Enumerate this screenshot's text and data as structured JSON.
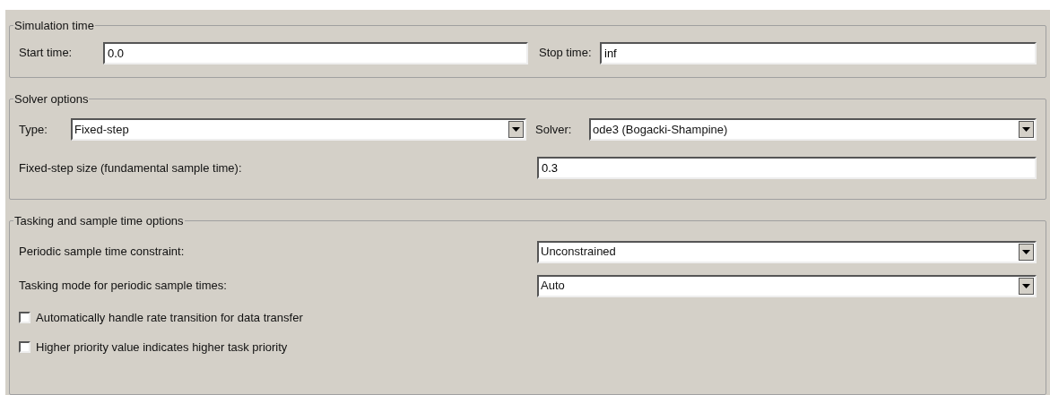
{
  "simulation_time": {
    "title": "Simulation time",
    "start": {
      "label": "Start time:",
      "value": "0.0"
    },
    "stop": {
      "label": "Stop time:",
      "value": "inf"
    }
  },
  "solver_options": {
    "title": "Solver options",
    "type": {
      "label": "Type:",
      "value": "Fixed-step"
    },
    "solver": {
      "label": "Solver:",
      "value": "ode3 (Bogacki-Shampine)"
    },
    "fixed_step_size": {
      "label": "Fixed-step size (fundamental sample time):",
      "value": "0.3"
    }
  },
  "tasking": {
    "title": "Tasking and sample time options",
    "rows": [
      {
        "kind": "dropdown",
        "label": "Periodic sample time constraint:",
        "value": "Unconstrained"
      },
      {
        "kind": "dropdown",
        "label": "Tasking mode for periodic sample times:",
        "value": "Auto"
      },
      {
        "kind": "checkbox",
        "label": "Automatically handle rate transition for data transfer",
        "checked": false
      },
      {
        "kind": "checkbox",
        "label": "Higher priority value indicates higher task priority",
        "checked": false
      }
    ]
  }
}
